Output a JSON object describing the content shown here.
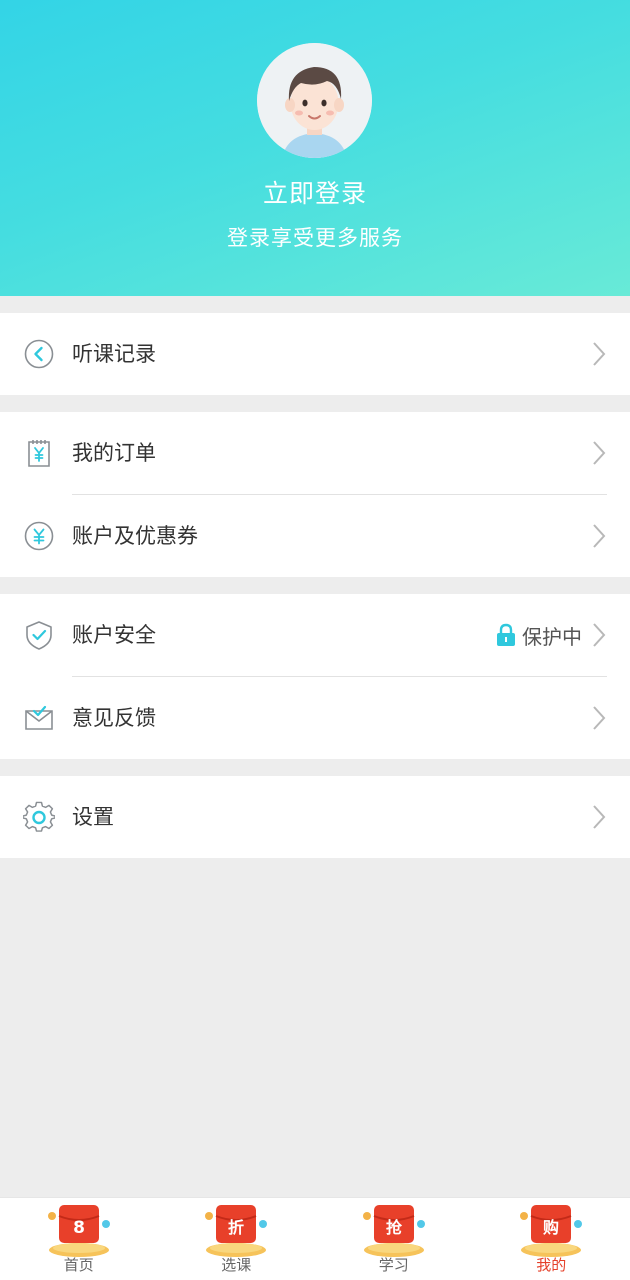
{
  "header": {
    "login_title": "立即登录",
    "login_subtitle": "登录享受更多服务",
    "gradient_start": "#33d4e6",
    "gradient_end": "#68ead7"
  },
  "menu": {
    "history": {
      "label": "听课记录",
      "icon": "clock-back-icon"
    },
    "orders": {
      "label": "我的订单",
      "icon": "receipt-yuan-icon"
    },
    "coupons": {
      "label": "账户及优惠券",
      "icon": "yuan-circle-icon"
    },
    "security": {
      "label": "账户安全",
      "icon": "shield-check-icon",
      "status": "保护中",
      "status_icon": "lock-icon"
    },
    "feedback": {
      "label": "意见反馈",
      "icon": "envelope-icon"
    },
    "settings": {
      "label": "设置",
      "icon": "gear-icon"
    }
  },
  "tabbar": {
    "items": [
      {
        "label": "首页",
        "badge_char": "8",
        "active": false
      },
      {
        "label": "选课",
        "badge_char": "折",
        "active": false
      },
      {
        "label": "学习",
        "badge_char": "抢",
        "active": false
      },
      {
        "label": "我的",
        "badge_char": "购",
        "active": true
      }
    ],
    "active_color": "#e5402a",
    "badge_color": "#e8402a"
  }
}
